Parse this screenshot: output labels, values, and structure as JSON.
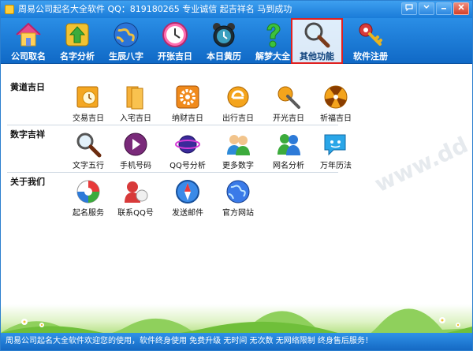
{
  "window": {
    "title": "周易公司起名大全软件   QQ：819180265   专业诚信  起吉祥名  马到成功"
  },
  "toolbar": {
    "items": [
      {
        "label": "公司取名",
        "icon": "house-icon"
      },
      {
        "label": "名字分析",
        "icon": "arrow-up-icon"
      },
      {
        "label": "生辰八字",
        "icon": "globe-icon"
      },
      {
        "label": "开张吉日",
        "icon": "clock-icon"
      },
      {
        "label": "本日黄历",
        "icon": "alarm-clock-icon"
      },
      {
        "label": "解梦大全",
        "icon": "question-icon"
      },
      {
        "label": "其他功能",
        "icon": "magnifier-icon"
      },
      {
        "label": "软件注册",
        "icon": "key-icon"
      }
    ],
    "active_index": 6
  },
  "sections": [
    {
      "title": "黄道吉日",
      "items": [
        {
          "label": "交易吉日",
          "icon": "calendar-icon"
        },
        {
          "label": "入宅吉日",
          "icon": "folder-icon"
        },
        {
          "label": "纳财吉日",
          "icon": "gear-icon"
        },
        {
          "label": "出行吉日",
          "icon": "ie-icon"
        },
        {
          "label": "开光吉日",
          "icon": "tools-icon"
        },
        {
          "label": "祈福吉日",
          "icon": "radiation-icon"
        }
      ]
    },
    {
      "title": "数字吉祥",
      "items": [
        {
          "label": "文字五行",
          "icon": "magnifier-icon"
        },
        {
          "label": "手机号码",
          "icon": "phone-ball-icon"
        },
        {
          "label": "QQ号分析",
          "icon": "orbit-icon"
        },
        {
          "label": "更多数字",
          "icon": "users-icon"
        },
        {
          "label": "网名分析",
          "icon": "messenger-icon"
        },
        {
          "label": "万年历法",
          "icon": "chat-face-icon"
        }
      ]
    },
    {
      "title": "关于我们",
      "items": [
        {
          "label": "起名服务",
          "icon": "media-icon"
        },
        {
          "label": "联系QQ号",
          "icon": "contact-icon"
        },
        {
          "label": "发送邮件",
          "icon": "compass-icon"
        },
        {
          "label": "官方网站",
          "icon": "web-globe-icon"
        }
      ]
    }
  ],
  "status": {
    "text": "周易公司起名大全软件欢迎您的使用，软件终身使用  免费升级  无时间  无次数  无网络限制  终身售后服务！"
  },
  "colors": {
    "titlebar": "#1a7bd8",
    "toolbar": "#1069c6",
    "active_border": "#e02020"
  }
}
